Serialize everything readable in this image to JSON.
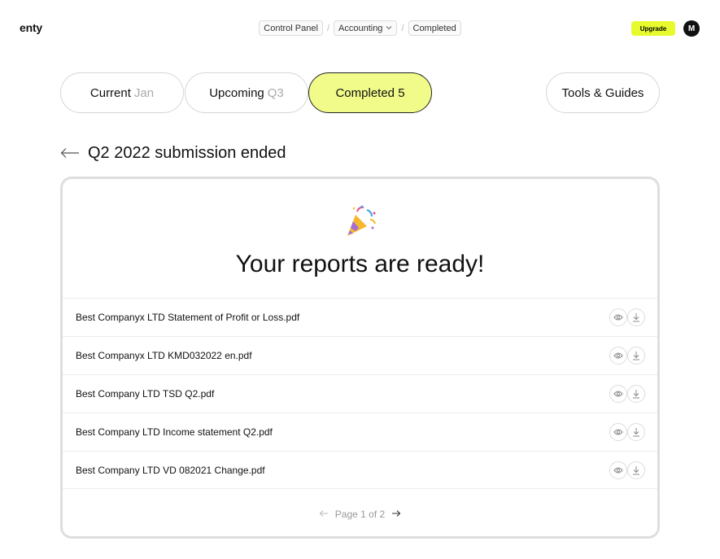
{
  "app": {
    "logo": "enty"
  },
  "breadcrumb": {
    "items": [
      "Control Panel",
      "Accounting",
      "Completed"
    ],
    "separator": "/"
  },
  "header": {
    "upgrade_label": "Upgrade",
    "avatar_initial": "M"
  },
  "tabs": [
    {
      "label": "Current",
      "sub": "Jan",
      "active": false
    },
    {
      "label": "Upcoming",
      "sub": "Q3",
      "active": false
    },
    {
      "label": "Completed",
      "sub": "5",
      "active": true
    }
  ],
  "tools_label": "Tools & Guides",
  "section": {
    "title": "Q2 2022 submission ended"
  },
  "card": {
    "title": "Your reports are ready!",
    "files": [
      "Best Companyx LTD Statement of Profit or Loss.pdf",
      "Best Companyx LTD KMD032022 en.pdf",
      "Best Company LTD TSD Q2.pdf",
      "Best Company LTD Income statement Q2.pdf",
      "Best Company LTD VD 082021 Change.pdf"
    ]
  },
  "pagination": {
    "label": "Page 1 of 2",
    "prev_icon": "arrow-left-icon",
    "next_icon": "arrow-right-icon"
  },
  "colors": {
    "accent": "#e7fa2d",
    "active_tab": "#f1fb8a",
    "border": "#dedede"
  }
}
